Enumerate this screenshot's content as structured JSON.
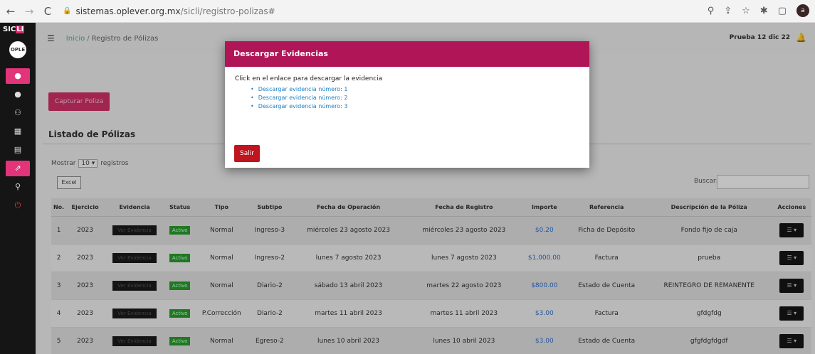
{
  "browser": {
    "back": "←",
    "forward": "→",
    "reload": "C",
    "url_host": "sistemas.oplever.org.mx",
    "url_path": "/sicli/registro-polizas#",
    "profile": "a"
  },
  "sidebar": {
    "brand_left": "SIC",
    "brand_accent": "LI",
    "logo": "OPLE",
    "items": [
      {
        "icon": "dashboard-icon",
        "glyph": "●"
      },
      {
        "icon": "circle-icon",
        "glyph": "●"
      },
      {
        "icon": "users-icon",
        "glyph": "⚇"
      },
      {
        "icon": "calendar-icon",
        "glyph": "▦"
      },
      {
        "icon": "file-icon",
        "glyph": "▤"
      },
      {
        "icon": "chart-icon",
        "glyph": "⇗"
      },
      {
        "icon": "search-icon",
        "glyph": "⚲"
      },
      {
        "icon": "power-icon",
        "glyph": "⏻"
      }
    ]
  },
  "header": {
    "breadcrumb_home": "Inicio",
    "breadcrumb_current": "Registro de Pólizas",
    "user": "Prueba 12 dic 22"
  },
  "main": {
    "capture_button": "Capturar Poliza",
    "section_title": "Listado de Pólizas",
    "show_label": "Mostrar",
    "page_length": "10",
    "records_label": "registros",
    "excel_button": "Excel",
    "search_label": "Buscar:"
  },
  "table": {
    "headers": [
      "No.",
      "Ejercicio",
      "Evidencia",
      "Status",
      "Tipo",
      "Subtipo",
      "Fecha de Operación",
      "Fecha de Registro",
      "Importe",
      "Referencia",
      "Descripción de la Póliza",
      "Acciones"
    ],
    "rows": [
      {
        "no": "1",
        "ejercicio": "2023",
        "evidencia": "Ver Evidencia",
        "status": "Activo",
        "tipo": "Normal",
        "subtipo": "Ingreso-3",
        "fecha_op": "miércoles 23 agosto 2023",
        "fecha_reg": "miércoles 23 agosto 2023",
        "importe": "$0.20",
        "referencia": "Ficha de Depósito",
        "descripcion": "Fondo fijo de caja",
        "accion": "☰ ▾"
      },
      {
        "no": "2",
        "ejercicio": "2023",
        "evidencia": "Ver Evidencia",
        "status": "Activo",
        "tipo": "Normal",
        "subtipo": "Ingreso-2",
        "fecha_op": "lunes 7 agosto 2023",
        "fecha_reg": "lunes 7 agosto 2023",
        "importe": "$1,000.00",
        "referencia": "Factura",
        "descripcion": "prueba",
        "accion": "☰ ▾"
      },
      {
        "no": "3",
        "ejercicio": "2023",
        "evidencia": "Ver Evidencia",
        "status": "Activo",
        "tipo": "Normal",
        "subtipo": "Diario-2",
        "fecha_op": "sábado 13 abril 2023",
        "fecha_reg": "martes 22 agosto 2023",
        "importe": "$800.00",
        "referencia": "Estado de Cuenta",
        "descripcion": "REINTEGRO DE REMANENTE",
        "accion": "☰ ▾"
      },
      {
        "no": "4",
        "ejercicio": "2023",
        "evidencia": "Ver Evidencia",
        "status": "Activo",
        "tipo": "P.Corrección",
        "subtipo": "Diario-2",
        "fecha_op": "martes 11 abril 2023",
        "fecha_reg": "martes 11 abril 2023",
        "importe": "$3.00",
        "referencia": "Factura",
        "descripcion": "gfdgfdg",
        "accion": "☰ ▾"
      },
      {
        "no": "5",
        "ejercicio": "2023",
        "evidencia": "Ver Evidencia",
        "status": "Activo",
        "tipo": "Normal",
        "subtipo": "Egreso-2",
        "fecha_op": "lunes 10 abril 2023",
        "fecha_reg": "lunes 10 abril 2023",
        "importe": "$3.00",
        "referencia": "Estado de Cuenta",
        "descripcion": "gfgfdgfdgdf",
        "accion": "☰ ▾"
      }
    ]
  },
  "modal": {
    "title": "Descargar Evidencias",
    "instruction": "Click en el enlace para descargar la evidencia",
    "links": [
      "Descargar evidencia número: 1",
      "Descargar evidencia número: 2",
      "Descargar evidencia número: 3"
    ],
    "exit_button": "Salir"
  },
  "colors": {
    "accent": "#b01557",
    "sidebar_active": "#e23478",
    "status_green": "#2a9a2a",
    "link_blue": "#1b7fc4",
    "exit_red": "#c0141f"
  }
}
